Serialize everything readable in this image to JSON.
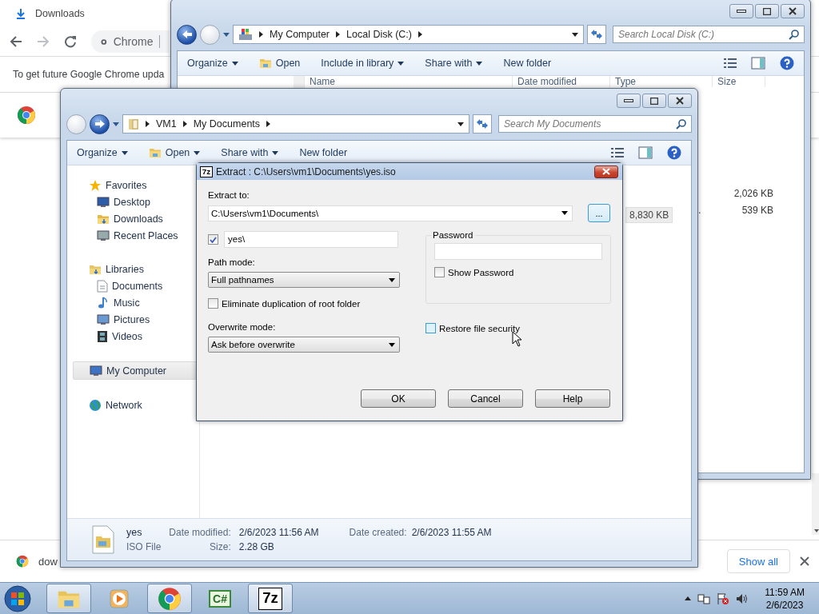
{
  "browser": {
    "tab": {
      "title": "Downloads"
    },
    "omnibox": {
      "text": "Chrome"
    },
    "infobar": {
      "text": "To get future Google Chrome upda"
    },
    "download_shelf": {
      "item": "dow",
      "show_all": "Show all"
    }
  },
  "explorer_back": {
    "breadcrumb": [
      "My Computer",
      "Local Disk (C:)"
    ],
    "search": {
      "placeholder": "Search Local Disk (C:)"
    },
    "toolbar": [
      {
        "label": "Organize",
        "menu": true,
        "kind": "text"
      },
      {
        "label": "Open",
        "menu": false,
        "kind": "folder"
      },
      {
        "label": "Include in library",
        "menu": true,
        "kind": "text"
      },
      {
        "label": "Share with",
        "menu": true,
        "kind": "text"
      },
      {
        "label": "New folder",
        "menu": false,
        "kind": "text"
      }
    ],
    "columns": [
      "Name",
      "Date modified",
      "Type",
      "Size"
    ],
    "rows": [
      {
        "size": "2,026 KB",
        "selected": false
      },
      {
        "type": "…",
        "size": "539 KB",
        "selected": false
      }
    ],
    "tooltip": "8,830 KB"
  },
  "explorer_front": {
    "nav": {
      "back_disabled": true,
      "forward_disabled": false
    },
    "breadcrumb": [
      "VM1",
      "My Documents"
    ],
    "search": {
      "placeholder": "Search My Documents"
    },
    "toolbar": [
      {
        "label": "Organize",
        "menu": true,
        "kind": "text"
      },
      {
        "label": "Open",
        "menu": true,
        "kind": "folder"
      },
      {
        "label": "Share with",
        "menu": true,
        "kind": "text"
      },
      {
        "label": "New folder",
        "menu": false,
        "kind": "text"
      }
    ],
    "sidebar": [
      {
        "label": "Favorites",
        "kind": "star",
        "selected": false,
        "children": [
          {
            "label": "Desktop",
            "kind": "desktop",
            "selected": false
          },
          {
            "label": "Downloads",
            "kind": "downloads",
            "selected": false
          },
          {
            "label": "Recent Places",
            "kind": "recent",
            "selected": false
          }
        ]
      },
      {
        "label": "Libraries",
        "kind": "library",
        "selected": false,
        "children": [
          {
            "label": "Documents",
            "kind": "document",
            "selected": false
          },
          {
            "label": "Music",
            "kind": "music",
            "selected": false
          },
          {
            "label": "Pictures",
            "kind": "pictures",
            "selected": false
          },
          {
            "label": "Videos",
            "kind": "videos",
            "selected": false
          }
        ]
      },
      {
        "label": "My Computer",
        "kind": "computer",
        "selected": true
      },
      {
        "label": "Network",
        "kind": "network",
        "selected": false
      }
    ],
    "details": {
      "name": "yes",
      "type": "ISO File",
      "fields": [
        {
          "label": "Date modified:",
          "value": "2/6/2023 11:56 AM"
        },
        {
          "label": "Size:",
          "value": "2.28 GB"
        },
        {
          "label": "Date created:",
          "value": "2/6/2023 11:55 AM"
        }
      ]
    }
  },
  "dialog": {
    "icon_label": "7z",
    "title": "Extract : C:\\Users\\vm1\\Documents\\yes.iso",
    "extract_to": {
      "label": "Extract to:",
      "value": "C:\\Users\\vm1\\Documents\\"
    },
    "browse": "...",
    "subfolder": {
      "checked": true,
      "value": "yes\\"
    },
    "path_mode": {
      "label": "Path mode:",
      "value": "Full pathnames"
    },
    "eliminate_root": {
      "label": "Eliminate duplication of root folder",
      "checked": false
    },
    "overwrite_mode": {
      "label": "Overwrite mode:",
      "value": "Ask before overwrite"
    },
    "password": {
      "label": "Password",
      "show_label": "Show Password",
      "show_checked": false
    },
    "restore_security": {
      "label": "Restore file security",
      "checked": false,
      "hover": true
    },
    "buttons": [
      "OK",
      "Cancel",
      "Help"
    ]
  },
  "taskbar": {
    "items": [
      {
        "kind": "explorer",
        "active": true
      },
      {
        "kind": "media",
        "active": false
      },
      {
        "kind": "chrome",
        "active": true
      },
      {
        "kind": "csharp",
        "label": "C#",
        "active": false
      },
      {
        "kind": "sevenzip",
        "label": "7z",
        "active": true
      }
    ],
    "clock": {
      "time": "11:59 AM",
      "date": "2/6/2023"
    }
  }
}
